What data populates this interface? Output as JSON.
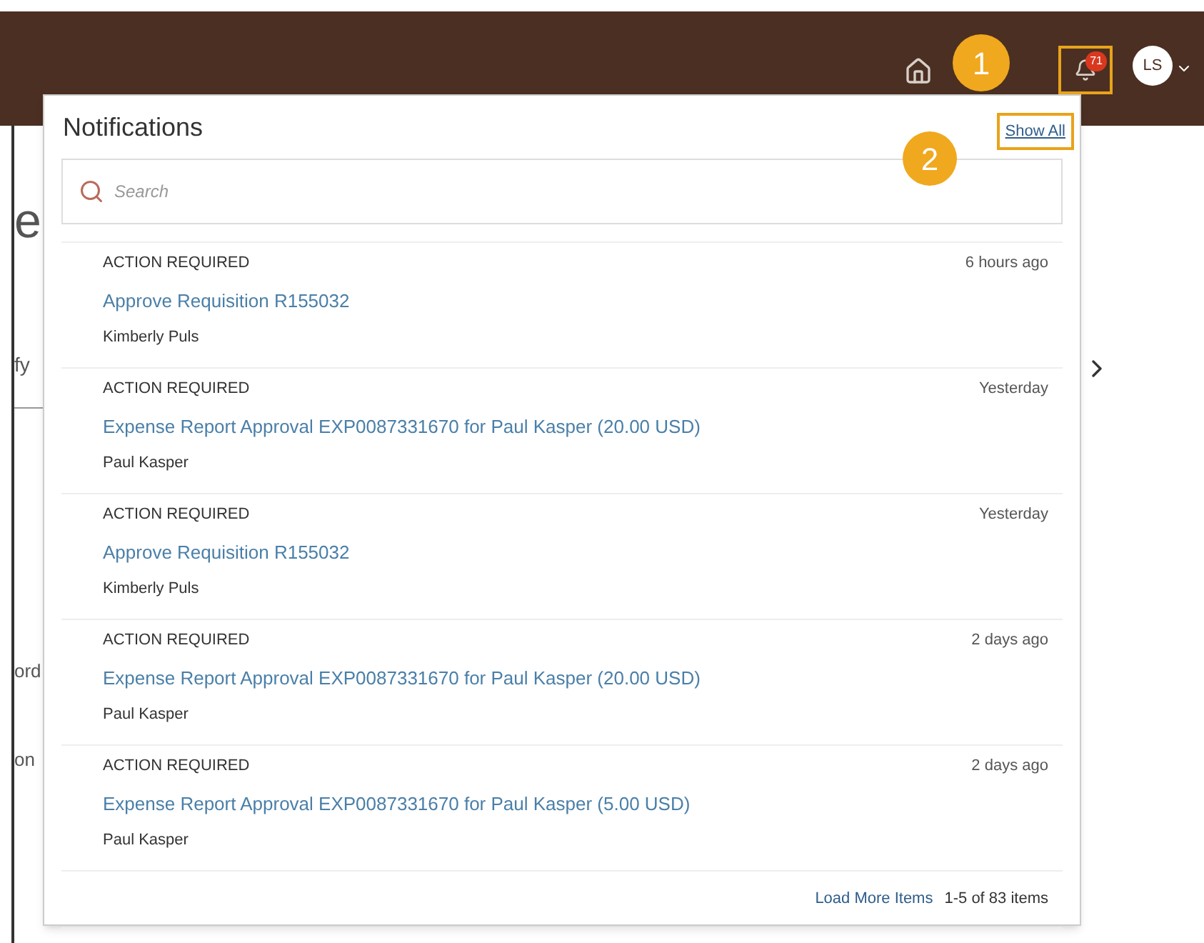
{
  "header": {
    "badge": "71",
    "avatar": "LS",
    "callouts": [
      "1",
      "2"
    ]
  },
  "background": {
    "texts": [
      "e",
      "fy",
      "ord",
      "on"
    ]
  },
  "notifications": {
    "title": "Notifications",
    "show_all": "Show All",
    "search": {
      "placeholder": "Search"
    },
    "items": [
      {
        "category": "ACTION REQUIRED",
        "time": "6 hours ago",
        "link": "Approve Requisition R155032",
        "person": "Kimberly Puls"
      },
      {
        "category": "ACTION REQUIRED",
        "time": "Yesterday",
        "link": "Expense Report Approval EXP0087331670 for Paul Kasper (20.00 USD)",
        "person": "Paul Kasper"
      },
      {
        "category": "ACTION REQUIRED",
        "time": "Yesterday",
        "link": "Approve Requisition R155032",
        "person": "Kimberly Puls"
      },
      {
        "category": "ACTION REQUIRED",
        "time": "2 days ago",
        "link": "Expense Report Approval EXP0087331670 for Paul Kasper (20.00 USD)",
        "person": "Paul Kasper"
      },
      {
        "category": "ACTION REQUIRED",
        "time": "2 days ago",
        "link": "Expense Report Approval EXP0087331670 for Paul Kasper (5.00 USD)",
        "person": "Paul Kasper"
      }
    ],
    "load_more": "Load More Items",
    "count": "1-5 of 83 items"
  }
}
